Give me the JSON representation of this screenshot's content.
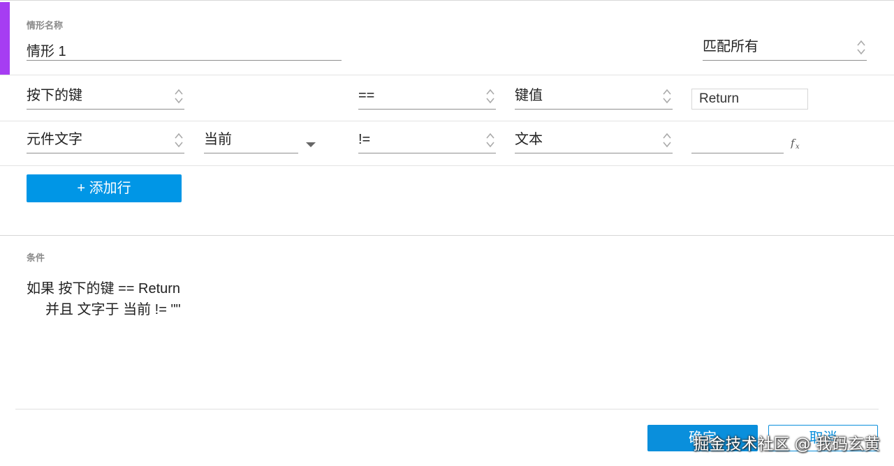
{
  "header": {
    "name_label": "情形名称",
    "name_value": "情形 1",
    "match_mode": "匹配所有"
  },
  "rows": [
    {
      "field": "按下的键",
      "operator": "==",
      "value_type": "键值",
      "value": "Return"
    },
    {
      "field": "元件文字",
      "target": "当前",
      "operator": "!=",
      "value_type": "文本",
      "value": "",
      "fx_icon": "fx-icon"
    }
  ],
  "add_row_label": "+ 添加行",
  "condition": {
    "label": "条件",
    "line1": "如果 按下的键 == Return",
    "line2": "并且 文字于 当前 != \"\""
  },
  "footer": {
    "ok_label": "确定",
    "cancel_label": "取消"
  },
  "watermark": "掘金技术社区 @ 我码玄黄",
  "colors": {
    "accent": "#a63df2",
    "primary": "#0096e6"
  }
}
